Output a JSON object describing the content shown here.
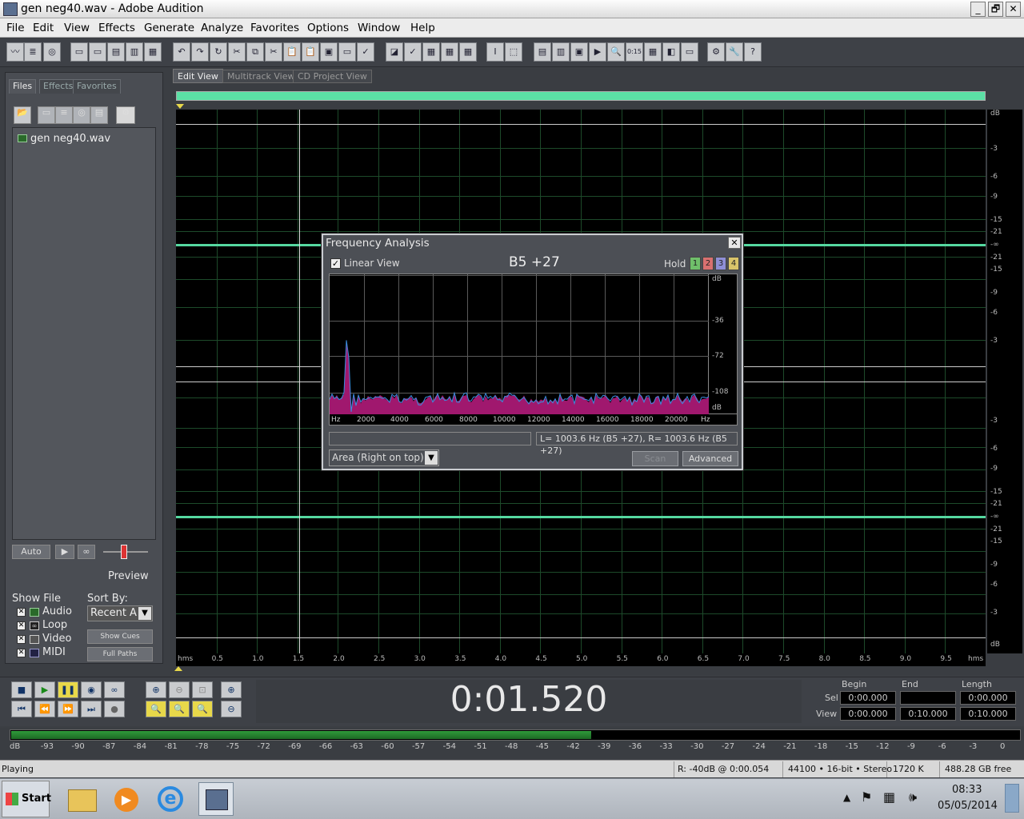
{
  "window": {
    "title": "gen neg40.wav - Adobe Audition",
    "min": "_",
    "max": "🗗",
    "close": "✕"
  },
  "menu": [
    "File",
    "Edit",
    "View",
    "Effects",
    "Generate",
    "Analyze",
    "Favorites",
    "Options",
    "Window",
    "Help"
  ],
  "left_panel": {
    "tabs": [
      "Files",
      "Effects",
      "Favorites"
    ],
    "file_item": "gen neg40.wav",
    "auto_label": "Auto",
    "preview_label": "Preview",
    "show_file_label": "Show File",
    "sort_by_label": "Sort By:",
    "sort_value": "Recent A",
    "file_types": [
      "Audio",
      "Loop",
      "Video",
      "MIDI"
    ],
    "show_cues": "Show Cues",
    "full_paths": "Full Paths"
  },
  "view_tabs": [
    "Edit View",
    "Multitrack View",
    "CD Project View"
  ],
  "waveform": {
    "db_scale_top": [
      "dB",
      "-3",
      "-6",
      "-9",
      "-15",
      "-21",
      "-∞",
      "-21",
      "-15",
      "-9",
      "-6",
      "-3"
    ],
    "db_scale_bottom": [
      "-3",
      "-6",
      "-9",
      "-15",
      "-21",
      "-∞",
      "-21",
      "-15",
      "-9",
      "-6",
      "-3",
      "dB"
    ],
    "time_labels": [
      "hms",
      "0.5",
      "1.0",
      "1.5",
      "2.0",
      "2.5",
      "3.0",
      "3.5",
      "4.0",
      "4.5",
      "5.0",
      "5.5",
      "6.0",
      "6.5",
      "7.0",
      "7.5",
      "8.0",
      "8.5",
      "9.0",
      "9.5",
      "hms"
    ]
  },
  "freq_dialog": {
    "title": "Frequency Analysis",
    "close": "✕",
    "linear_view_label": "Linear View",
    "linear_view_checked": true,
    "note": "B5 +27",
    "hold_label": "Hold",
    "hold_buttons": [
      "1",
      "2",
      "3",
      "4"
    ],
    "hold_colors": [
      "#6fbf6a",
      "#d97070",
      "#8f8fd6",
      "#d9c46a"
    ],
    "y_labels": [
      "dB",
      "-36",
      "-72",
      "-108",
      "dB"
    ],
    "x_labels": [
      "Hz",
      "2000",
      "4000",
      "6000",
      "8000",
      "10000",
      "12000",
      "14000",
      "16000",
      "18000",
      "20000",
      "Hz"
    ],
    "readout": "L= 1003.6 Hz (B5 +27), R= 1003.6 Hz (B5 +27)",
    "display_mode": "Area (Right on top)",
    "scan_label": "Scan",
    "advanced_label": "Advanced"
  },
  "transport": {
    "time": "0:01.520",
    "begin_label": "Begin",
    "end_label": "End",
    "length_label": "Length",
    "sel_label": "Sel",
    "view_label": "View",
    "sel_begin": "0:00.000",
    "sel_end": "",
    "sel_length": "0:00.000",
    "view_begin": "0:00.000",
    "view_end": "0:10.000",
    "view_length": "0:10.000"
  },
  "meter": {
    "level_fraction": 0.575,
    "labels": [
      "dB",
      "-93",
      "-90",
      "-87",
      "-84",
      "-81",
      "-78",
      "-75",
      "-72",
      "-69",
      "-66",
      "-63",
      "-60",
      "-57",
      "-54",
      "-51",
      "-48",
      "-45",
      "-42",
      "-39",
      "-36",
      "-33",
      "-30",
      "-27",
      "-24",
      "-21",
      "-18",
      "-15",
      "-12",
      "-9",
      "-6",
      "-3",
      "0"
    ]
  },
  "status": {
    "state": "Playing",
    "level": "R: -40dB @   0:00.054",
    "format": "44100 • 16-bit • Stereo",
    "size": "1720 K",
    "free": "488.28 GB free"
  },
  "taskbar": {
    "start": "Start",
    "time": "08:33",
    "date": "05/05/2014"
  }
}
